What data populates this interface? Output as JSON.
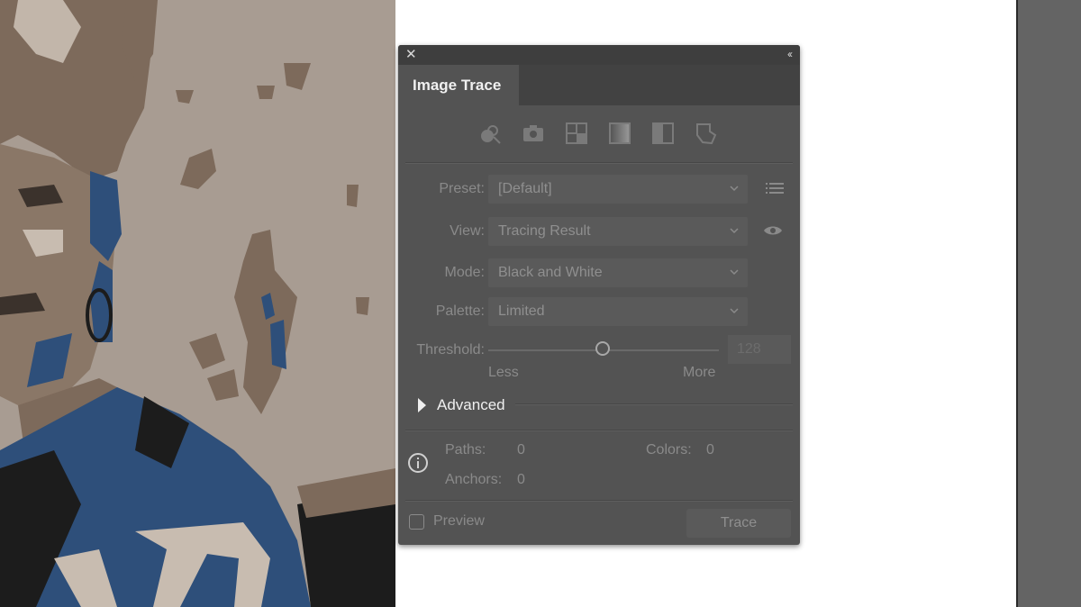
{
  "panel": {
    "tab_title": "Image Trace",
    "close_glyph": "✕",
    "collapse_glyph": "‹‹",
    "preset_buttons": [
      "auto-color-icon",
      "high-color-camera-icon",
      "low-color-icon",
      "grayscale-icon",
      "black-and-white-icon",
      "outline-icon"
    ],
    "preset": {
      "label": "Preset:",
      "value": "[Default]"
    },
    "view": {
      "label": "View:",
      "value": "Tracing Result"
    },
    "mode": {
      "label": "Mode:",
      "value": "Black and White"
    },
    "palette": {
      "label": "Palette:",
      "value": "Limited"
    },
    "threshold": {
      "label": "Threshold:",
      "value": "128",
      "less": "Less",
      "more": "More",
      "level": 0.5
    },
    "advanced_label": "Advanced",
    "stats": {
      "paths_label": "Paths:",
      "paths_value": "0",
      "colors_label": "Colors:",
      "colors_value": "0",
      "anchors_label": "Anchors:",
      "anchors_value": "0"
    },
    "preview_label": "Preview",
    "preview_checked": false,
    "trace_label": "Trace"
  },
  "colors": {
    "panel_bg": "#535353",
    "artwork_beige": "#a89c92",
    "artwork_brown": "#7d6a5b",
    "artwork_blue": "#2e4f7a",
    "artwork_dark": "#1c1c1c"
  }
}
